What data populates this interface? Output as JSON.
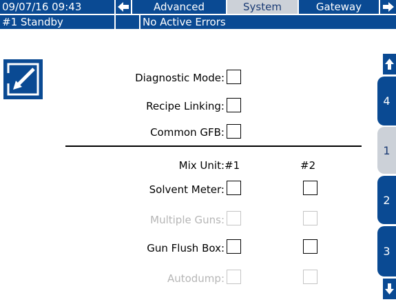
{
  "header": {
    "datetime": "09/07/16 09:43",
    "tabs": [
      {
        "label": "Advanced",
        "active": false
      },
      {
        "label": "System",
        "active": true
      },
      {
        "label": "Gateway",
        "active": false
      }
    ],
    "status": "#1 Standby",
    "errors": "No Active Errors"
  },
  "settings": {
    "diagnostic_mode": "Diagnostic Mode:",
    "recipe_linking": "Recipe Linking:",
    "common_gfb": "Common GFB:"
  },
  "mix_unit": {
    "label": "Mix Unit:",
    "col1": "#1",
    "col2": "#2",
    "rows": [
      {
        "label": "Solvent Meter:",
        "enabled": true
      },
      {
        "label": "Multiple Guns:",
        "enabled": false
      },
      {
        "label": "Gun Flush Box:",
        "enabled": true
      },
      {
        "label": "Autodump:",
        "enabled": false
      }
    ]
  },
  "side_nav": {
    "pages": [
      "4",
      "1",
      "2",
      "3"
    ],
    "active_page": "1"
  },
  "icons": {
    "prev_tab": "left-arrow-icon",
    "next_tab": "right-arrow-icon",
    "edit": "edit-icon",
    "page_up": "up-arrow-icon",
    "page_down": "down-arrow-icon"
  },
  "colors": {
    "primary": "#0a4a93",
    "active_tab": "#ccd1d8",
    "disabled": "#b6b6b6"
  }
}
